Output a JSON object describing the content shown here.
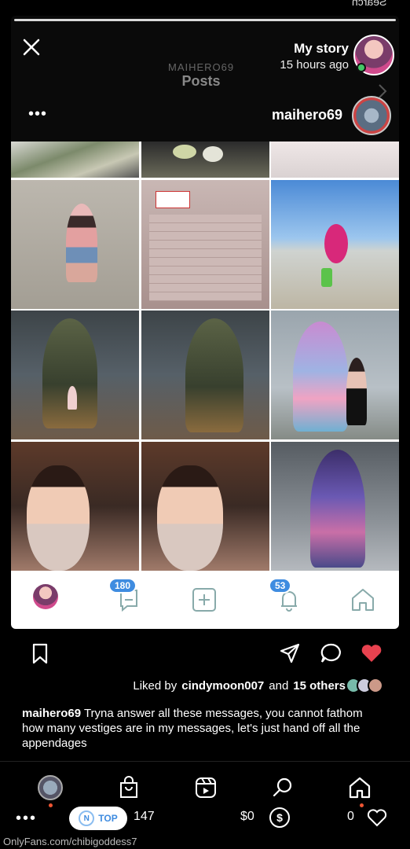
{
  "status": {
    "top_cut": "Search"
  },
  "story": {
    "user": "My story",
    "time": "15 hours ago"
  },
  "profile": {
    "ghost_handle": "MAIHERO69",
    "ghost_tab": "Posts",
    "name": "maihero69",
    "menu": "•••"
  },
  "grid_tiles": [
    "money",
    "dark",
    "note-top",
    "beach1",
    "note",
    "beach2",
    "robot1",
    "robot2",
    "llama",
    "selfie1",
    "selfie2",
    "llama2"
  ],
  "nav": {
    "messages_badge": "180",
    "activity_badge": "53"
  },
  "likes": {
    "prefix": "Liked by",
    "user": "cindymoon007",
    "suffix": "and",
    "others": "15 others"
  },
  "caption": {
    "user": "maihero69",
    "text": "Tryna answer all these messages, you cannot fathom how many vestiges are in my messages, let's just hand off all the appendages"
  },
  "bottom": {
    "likes_count": "0",
    "tips": "$0",
    "comments": "147",
    "pill_label": "N",
    "pill_top": "TOP"
  },
  "footer": "OnlyFans.com/chibigoddess7",
  "colors": {
    "accent": "#3f8ce0",
    "heart": "#e8424f",
    "online": "#44c767"
  }
}
